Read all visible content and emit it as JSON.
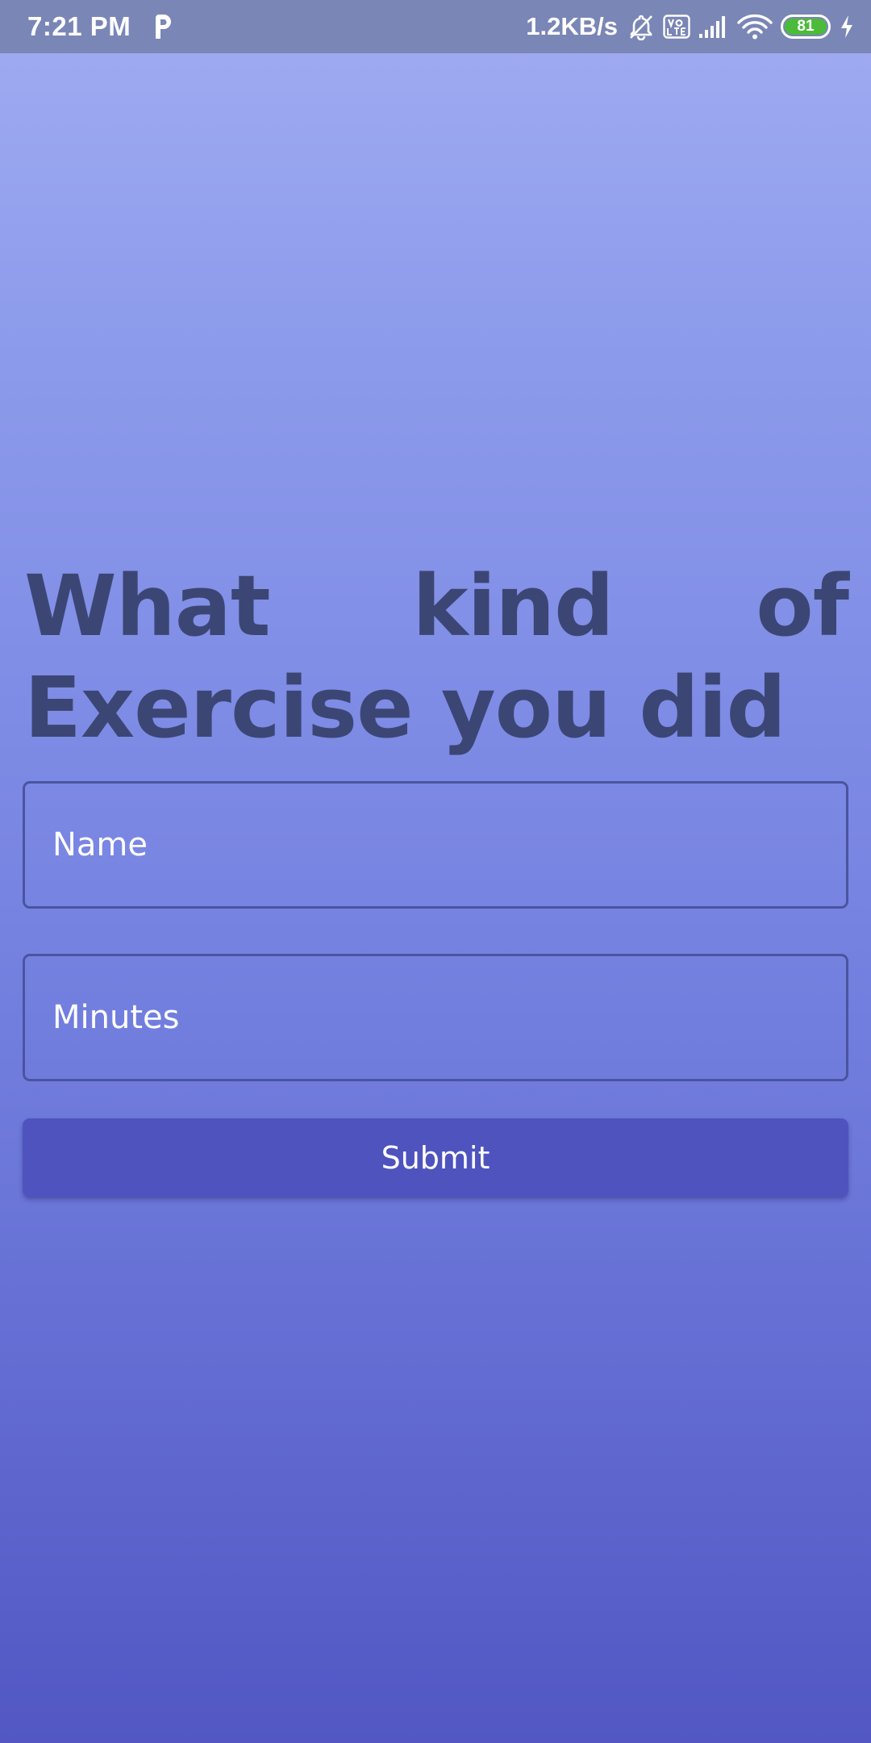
{
  "status_bar": {
    "time": "7:21 PM",
    "network_speed": "1.2KB/s",
    "battery_level": "81",
    "battery_fraction": 0.81,
    "icons": [
      "p-app-icon",
      "bell-off-icon",
      "volte-icon",
      "signal-icon",
      "wifi-icon",
      "battery-icon",
      "charging-bolt-icon"
    ],
    "battery_color": "#4cbb3a"
  },
  "form": {
    "heading": "What kind of Exercise you did",
    "name_placeholder": "Name",
    "minutes_placeholder": "Minutes",
    "submit_label": "Submit"
  },
  "colors": {
    "heading": "#3c4675",
    "button": "#4e53bd",
    "field_border": "#4a54a0",
    "gradient_top": "#a1acf1",
    "gradient_bottom": "#5257c3"
  }
}
